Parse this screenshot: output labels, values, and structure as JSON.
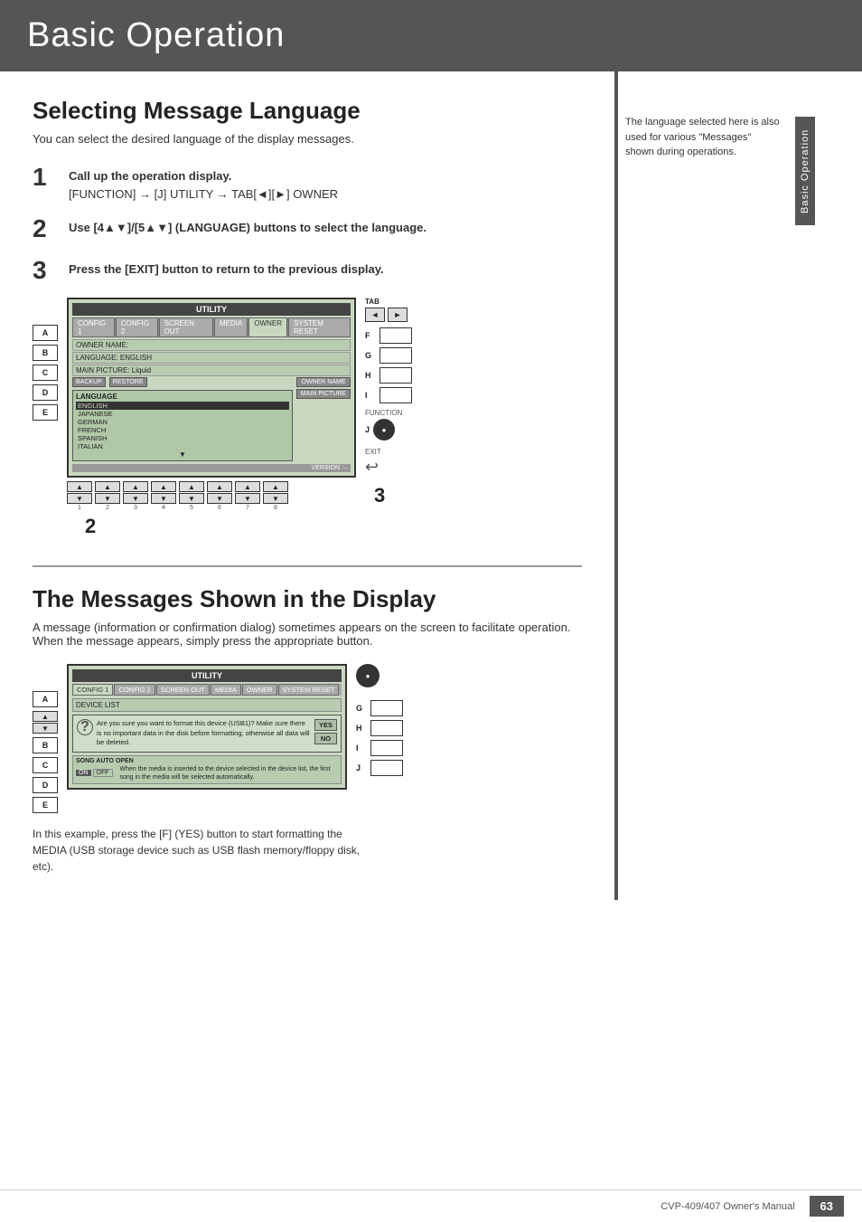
{
  "header": {
    "title": "Basic Operation"
  },
  "section1": {
    "title": "Selecting Message Language",
    "subtitle": "You can select the desired language of the display messages.",
    "steps": [
      {
        "number": "1",
        "text": "Call up the operation display.",
        "detail": "[FUNCTION] → [J] UTILITY → TAB[◄][►] OWNER"
      },
      {
        "number": "2",
        "text": "Use [4▲▼]/[5▲▼] (LANGUAGE) buttons to select the language."
      },
      {
        "number": "3",
        "text": "Press the [EXIT] button to return to the previous display."
      }
    ],
    "diagram": {
      "left_labels": [
        "A",
        "B",
        "C",
        "D",
        "E"
      ],
      "lcd": {
        "title": "UTILITY",
        "tabs": [
          "CONFIG 1",
          "CONFIG 2",
          "SCREEN OUT",
          "MEDIA",
          "OWNER",
          "SYSTEM RESET"
        ],
        "active_tab": "OWNER",
        "fields": [
          "OWNER NAME:",
          "LANGUAGE: ENGLISH",
          "MAIN PICTURE: Liquid"
        ],
        "buttons_left": [
          "BACKUP",
          "RESTORE"
        ],
        "language_dropdown": {
          "label": "LANGUAGE",
          "items": [
            "ENGLISH",
            "JAPANESE",
            "GERMAN",
            "FRENCH",
            "SPANISH",
            "ITALIAN"
          ],
          "selected": "ENGLISH"
        },
        "buttons_right": [
          "OWNER NAME",
          "MAIN PICTURE"
        ],
        "version": "VERSION"
      },
      "right_labels": [
        "F",
        "G",
        "H",
        "I",
        "J"
      ],
      "tab_buttons": [
        "◄",
        "►"
      ],
      "tab_label": "TAB",
      "function_label": "FUNCTION",
      "exit_label": "EXIT"
    },
    "step_labels": [
      "2",
      "3"
    ]
  },
  "section2": {
    "title": "The Messages Shown in the Display",
    "subtitle": "A message (information or confirmation dialog) sometimes appears on the screen to facilitate operation. When the message appears, simply press the appropriate button.",
    "diagram": {
      "left_labels": [
        "A",
        "B",
        "C",
        "D",
        "E"
      ],
      "lcd": {
        "title": "UTILITY",
        "tabs": [
          "CONFIG 1",
          "CONFIG 2",
          "SCREEN OUT",
          "MEDIA",
          "OWNER",
          "SYSTEM RESET"
        ],
        "active_tab": "CONFIG 1",
        "device_list": "DEVICE LIST",
        "dialog": {
          "question": "Are you sure you want to format this device (USB1)? Make sure there is no important data in the disk before formatting; otherwise all data will be deleted.",
          "yes": "YES",
          "no": "NO"
        },
        "song_auto_open": {
          "label": "SONG AUTO OPEN",
          "on": "ON",
          "off": "OFF",
          "description": "When the media is inserted to the device selected in the device list, the first song in the media will be selected automatically."
        }
      },
      "right_labels": [
        "G",
        "H",
        "I",
        "J"
      ]
    },
    "caption": "In this example, press the [F] (YES) button to start formatting the MEDIA (USB storage device such as USB flash memory/floppy disk, etc)."
  },
  "sidebar_note": "The language selected here is also used for various \"Messages\" shown during operations.",
  "sidebar_label": "Basic Operation",
  "footer": {
    "manual": "CVP-409/407 Owner's Manual",
    "page": "63"
  },
  "num_buttons": [
    "1",
    "2",
    "3",
    "4",
    "5",
    "6",
    "7",
    "8"
  ]
}
